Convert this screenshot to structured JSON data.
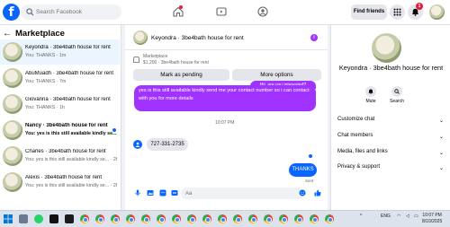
{
  "topbar": {
    "logo": "f",
    "search_placeholder": "Search Facebook",
    "find_friends": "Find friends",
    "notification_count": "1"
  },
  "sidebar": {
    "title": "Marketplace",
    "back_arrow": "←",
    "conversations": [
      {
        "name": "Keyondra · 3be4bath house for rent",
        "preview": "You: THANKS · 1m",
        "active": true,
        "unread": false
      },
      {
        "name": "AbuMuadh · 3be4bath house for rent",
        "preview": "You: THANKS · 7m",
        "active": false,
        "unread": false
      },
      {
        "name": "Giovanna · 3be4bath house for rent",
        "preview": "You: THANKS · 1h",
        "active": false,
        "unread": false
      },
      {
        "name": "Nancy · 3be4bath house for rent",
        "preview": "You: yes is this still available kindly se... · 2h",
        "active": false,
        "unread": true
      },
      {
        "name": "Charles · 3be4bath house for rent",
        "preview": "You: yes is this still available kindly se... · 2h",
        "active": false,
        "unread": false
      },
      {
        "name": "Alexis · 3be4bath house for rent",
        "preview": "You: yes is this still available kindly se... · 2h",
        "active": false,
        "unread": false
      }
    ]
  },
  "chat": {
    "title": "Keyondra · 3be4bath house for rent",
    "info_icon": "i",
    "marketplace_label": "Marketplace",
    "listing_price": "$1,200 · 3be4bath house for rent",
    "mark_pending": "Mark as pending",
    "more_options": "More options",
    "msg_top_partial": "Hii, are you interested?",
    "msg_outgoing": "yes is this still available kindly send me your contact number so i can contact with you for more details",
    "timestamp": "10:07 PM",
    "msg_incoming": "727-331-2735",
    "msg_thanks": "THANKS",
    "sent_label": "Sent",
    "composer_placeholder": "Aa"
  },
  "right_panel": {
    "name": "Keyondra · 3be4bath house for rent",
    "mute": "Mute",
    "search": "Search",
    "rows": [
      "Customize chat",
      "Chat members",
      "Media, files and links",
      "Privacy & support"
    ],
    "chevron": "⌄"
  },
  "taskbar": {
    "lang": "ENG",
    "time": "10:07 PM",
    "date": "8/10/2025"
  },
  "colors": {
    "accent": "#0866ff",
    "bubble_purple": "#a033ff",
    "badge_red": "#e41e3f"
  }
}
